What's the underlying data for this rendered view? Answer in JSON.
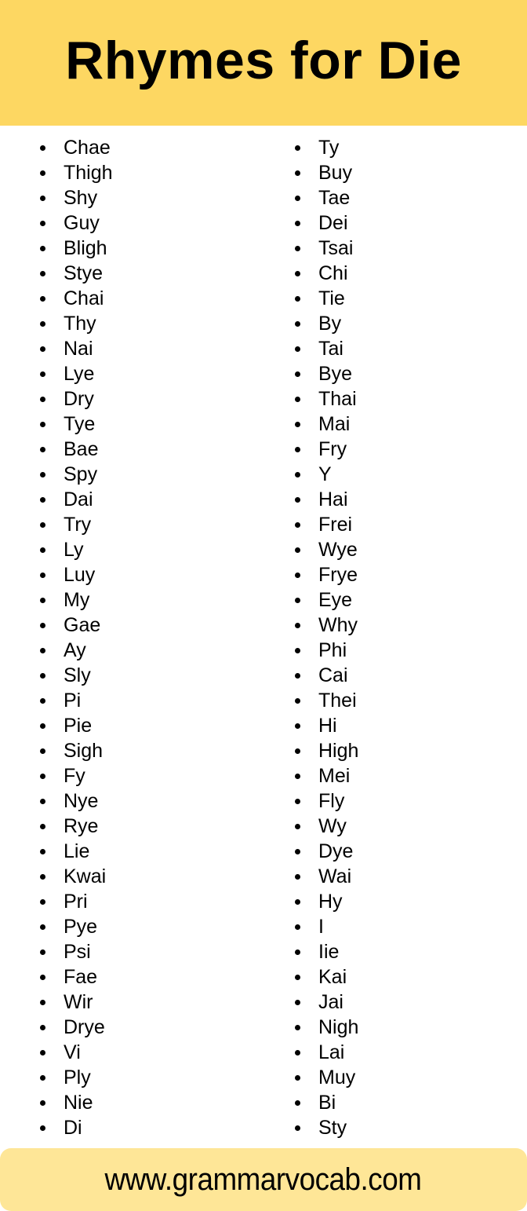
{
  "header": {
    "title": "Rhymes for Die",
    "background_color": "#FDD762"
  },
  "list": {
    "left_column": [
      "Chae",
      "Thigh",
      "Shy",
      "Guy",
      "Bligh",
      "Stye",
      "Chai",
      "Thy",
      "Nai",
      "Lye",
      "Dry",
      "Tye",
      "Bae",
      "Spy",
      "Dai",
      "Try",
      "Ly",
      "Luy",
      "My",
      "Gae",
      "Ay",
      "Sly",
      "Pi",
      "Pie",
      "Sigh",
      "Fy",
      "Nye",
      "Rye",
      "Lie",
      "Kwai",
      "Pri",
      "Pye",
      "Psi",
      "Fae",
      "Wir",
      "Drye",
      "Vi",
      "Ply",
      "Nie",
      "Di"
    ],
    "right_column": [
      "Ty",
      "Buy",
      "Tae",
      "Dei",
      "Tsai",
      "Chi",
      "Tie",
      "By",
      "Tai",
      "Bye",
      "Thai",
      "Mai",
      "Fry",
      "Y",
      "Hai",
      "Frei",
      "Wye",
      "Frye",
      "Eye",
      "Why",
      "Phi",
      "Cai",
      "Thei",
      "Hi",
      "High",
      "Mei",
      "Fly",
      "Wy",
      "Dye",
      "Wai",
      "Hy",
      "I",
      "Iie",
      "Kai",
      "Jai",
      "Nigh",
      "Lai",
      "Muy",
      "Bi",
      "Sty"
    ]
  },
  "footer": {
    "website": "www.grammarvocab.com",
    "background_color": "#FEE697"
  }
}
